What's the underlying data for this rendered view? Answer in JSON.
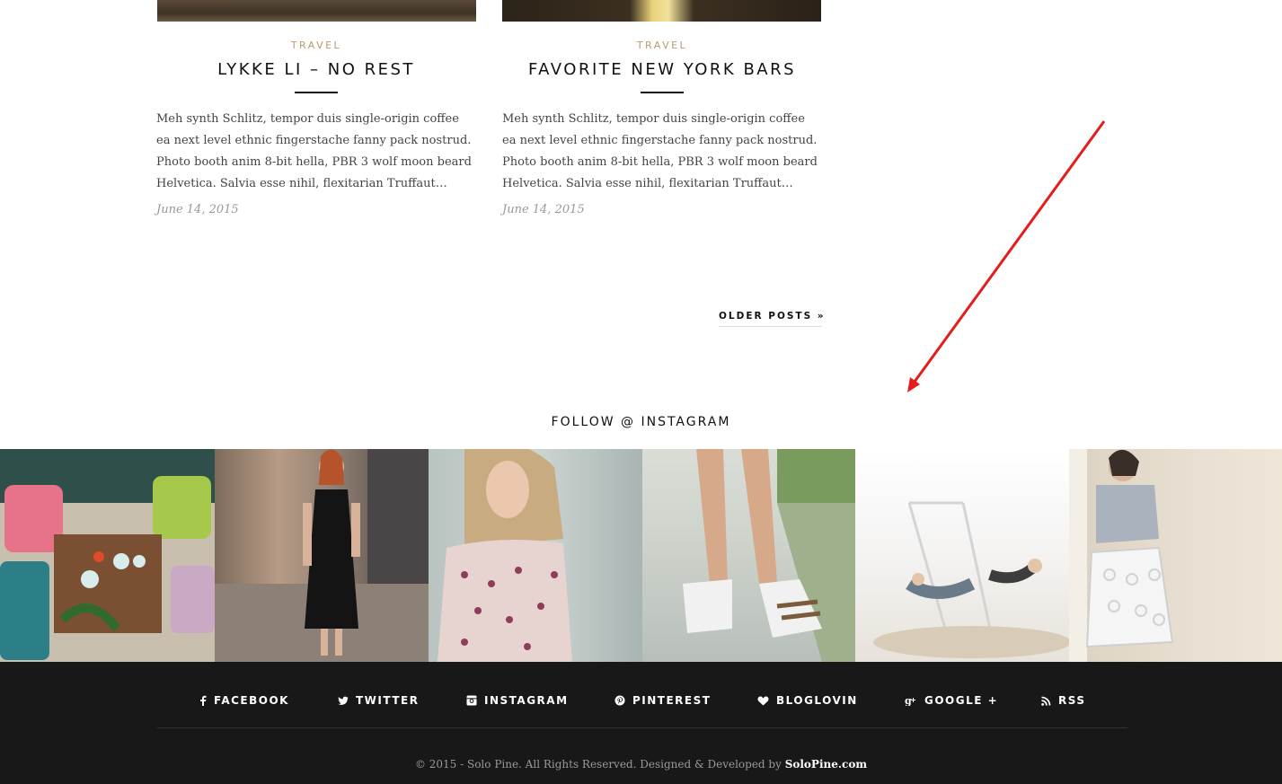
{
  "posts": [
    {
      "category": "TRAVEL",
      "title": "LYKKE LI – NO REST",
      "excerpt": "Meh synth Schlitz, tempor duis single-origin coffee ea next level ethnic fingerstache fanny pack nostrud. Photo booth anim 8-bit hella, PBR 3 wolf moon beard Helvetica. Salvia esse nihil, flexitarian Truffaut…",
      "date": "June 14, 2015"
    },
    {
      "category": "TRAVEL",
      "title": "FAVORITE NEW YORK BARS",
      "excerpt": "Meh synth Schlitz, tempor duis single-origin coffee ea next level ethnic fingerstache fanny pack nostrud. Photo booth anim 8-bit hella, PBR 3 wolf moon beard Helvetica. Salvia esse nihil, flexitarian Truffaut…",
      "date": "June 14, 2015"
    }
  ],
  "pagination": {
    "older_label": "OLDER POSTS »"
  },
  "instagram": {
    "heading": "FOLLOW @ INSTAGRAM",
    "tiles": [
      {
        "icon": "floor-cushions-photo"
      },
      {
        "icon": "woman-black-dress-photo"
      },
      {
        "icon": "woman-floral-top-photo"
      },
      {
        "icon": "sandals-photo"
      },
      {
        "icon": "swings-photo"
      },
      {
        "icon": "woman-white-skirt-photo"
      }
    ]
  },
  "footer": {
    "social": [
      {
        "label": "FACEBOOK",
        "icon": "facebook-icon"
      },
      {
        "label": "TWITTER",
        "icon": "twitter-icon"
      },
      {
        "label": "INSTAGRAM",
        "icon": "instagram-icon"
      },
      {
        "label": "PINTEREST",
        "icon": "pinterest-icon"
      },
      {
        "label": "BLOGLOVIN",
        "icon": "heart-icon"
      },
      {
        "label": "GOOGLE +",
        "icon": "google-plus-icon"
      },
      {
        "label": "RSS",
        "icon": "rss-icon"
      }
    ],
    "copyright_text": "© 2015 - Solo Pine. All Rights Reserved. Designed & Developed by ",
    "copyright_brand": "SoloPine.com"
  },
  "colors": {
    "accent": "#b99b72",
    "annotation_arrow": "#e51c1c",
    "footer_bg": "#181818"
  }
}
